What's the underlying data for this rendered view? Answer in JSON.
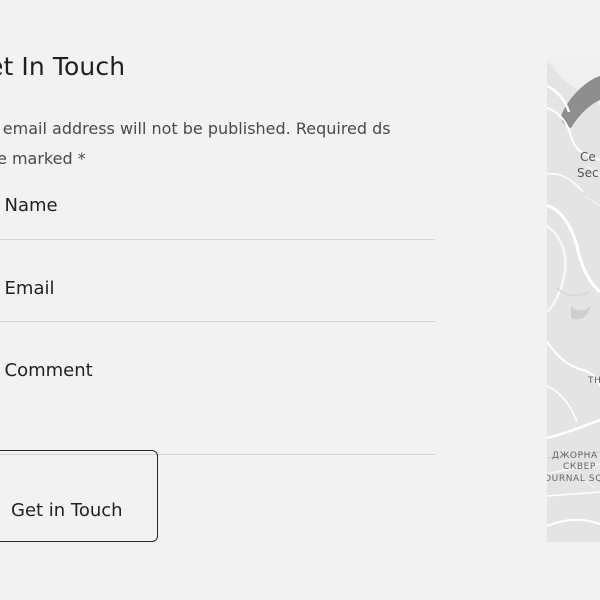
{
  "form": {
    "title": "et In Touch",
    "notice": "ur email address will not be published. Required ds are marked *",
    "name_placeholder": "ur Name",
    "email_placeholder": "ur Email",
    "comment_placeholder": "ur Comment",
    "submit_label": "Get in Touch"
  },
  "map": {
    "labels": {
      "l1": "Ce",
      "l2": "Sec",
      "l3": "TH",
      "l4": "ДЖОРНА",
      "l5": "СКВЕР",
      "l6": "OURNAL SQ"
    }
  }
}
